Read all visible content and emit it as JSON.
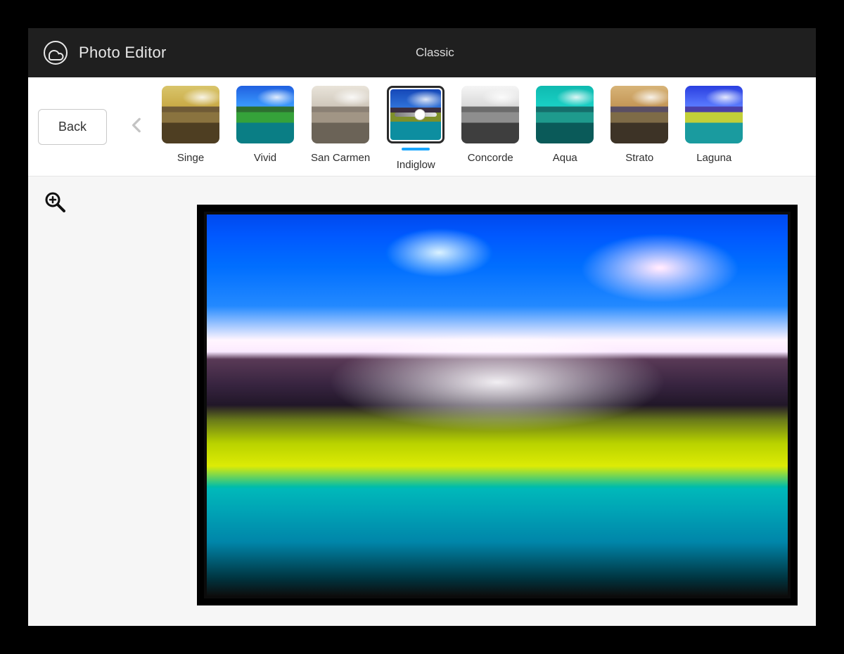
{
  "header": {
    "app_title": "Photo Editor",
    "category_label": "Classic"
  },
  "toolbar": {
    "back_label": "Back"
  },
  "filters": {
    "selected_index": 3,
    "items": [
      {
        "label": "Singe",
        "sky1": "#d9c56b",
        "sky2": "#c9aa46",
        "peak": "#6f5a36",
        "mid": "#8a733f",
        "low": "#4e3e22"
      },
      {
        "label": "Vivid",
        "sky1": "#2060e0",
        "sky2": "#3a9bff",
        "peak": "#2d6f30",
        "mid": "#35a23a",
        "low": "#0a7e85"
      },
      {
        "label": "San Carmen",
        "sky1": "#e9e4da",
        "sky2": "#cfc7bb",
        "peak": "#8a8074",
        "mid": "#a19585",
        "low": "#6b6357"
      },
      {
        "label": "Indiglow",
        "sky1": "#1648b8",
        "sky2": "#2f72d9",
        "peak": "#3b2e40",
        "mid": "#7e8f2a",
        "low": "#0d8ea0"
      },
      {
        "label": "Concorde",
        "sky1": "#f5f5f5",
        "sky2": "#d9d9d9",
        "peak": "#6b6b6b",
        "mid": "#8e8e8e",
        "low": "#3e3e3e"
      },
      {
        "label": "Aqua",
        "sky1": "#0fbab0",
        "sky2": "#19d0c5",
        "peak": "#156e6b",
        "mid": "#1e9a8d",
        "low": "#0a5a59"
      },
      {
        "label": "Strato",
        "sky1": "#d7b478",
        "sky2": "#c49656",
        "peak": "#5a4e63",
        "mid": "#7e6b47",
        "low": "#3d3326"
      },
      {
        "label": "Laguna",
        "sky1": "#2a3fe0",
        "sky2": "#5a7bff",
        "peak": "#4a3fa8",
        "mid": "#c2cf38",
        "low": "#1a9b9f"
      }
    ]
  },
  "colors": {
    "header_bg": "#1f1f1f",
    "accent_blue": "#1aa7ff"
  }
}
